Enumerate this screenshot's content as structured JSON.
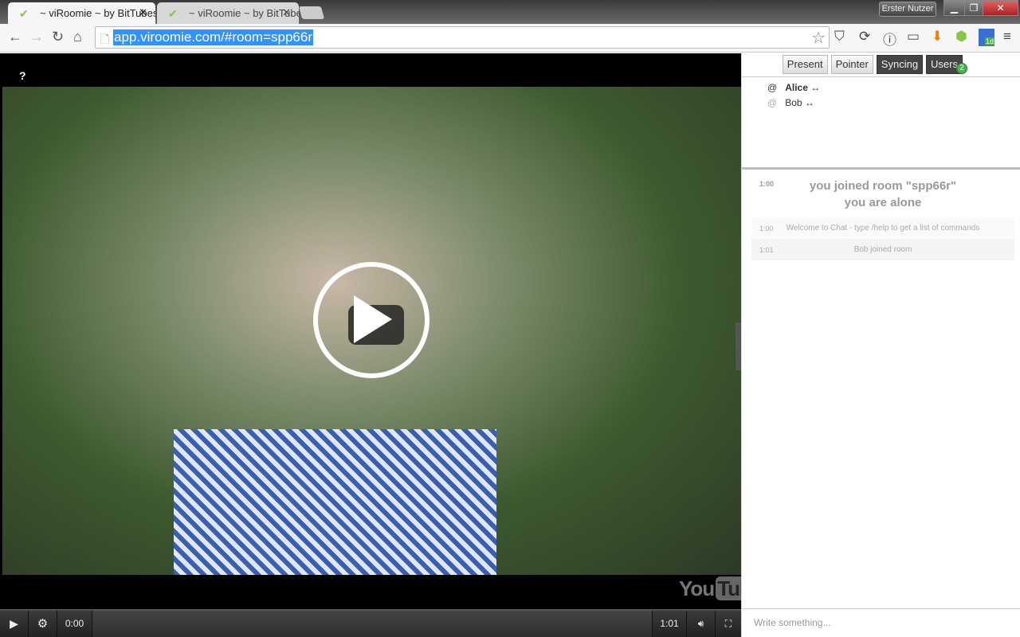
{
  "browser": {
    "tabs": [
      {
        "title": "~ viRoomie ~ by BitTubes",
        "active": true
      },
      {
        "title": "~ viRoomie ~ by BitTubes",
        "active": false
      }
    ],
    "profile": "Erster Nutzer",
    "url": "app.viroomie.com/#room=spp66r",
    "extension_badge": "1d"
  },
  "video": {
    "help": "?",
    "current_time": "0:00",
    "duration": "1:01",
    "logo_left": "You",
    "logo_right": "Tube",
    "progress": 0
  },
  "sidebar": {
    "buttons": [
      {
        "label": "Present",
        "active": false
      },
      {
        "label": "Pointer",
        "active": false
      },
      {
        "label": "Syncing",
        "active": true
      },
      {
        "label": "Users",
        "active": true
      }
    ],
    "users_count": "2",
    "users": [
      {
        "prefix": "@",
        "name": "Alice",
        "suffix": "↔"
      },
      {
        "prefix": "@",
        "name": "Bob",
        "suffix": "↔"
      }
    ],
    "chat": [
      {
        "time": "1:00",
        "line1": "you joined room \"spp66r\"",
        "line2": "you are alone"
      },
      {
        "time": "1:00",
        "text": "Welcome to Chat - type /help to get a list of commands"
      },
      {
        "time": "1:01",
        "text": "Bob joined room"
      }
    ],
    "input_placeholder": "Write something..."
  }
}
